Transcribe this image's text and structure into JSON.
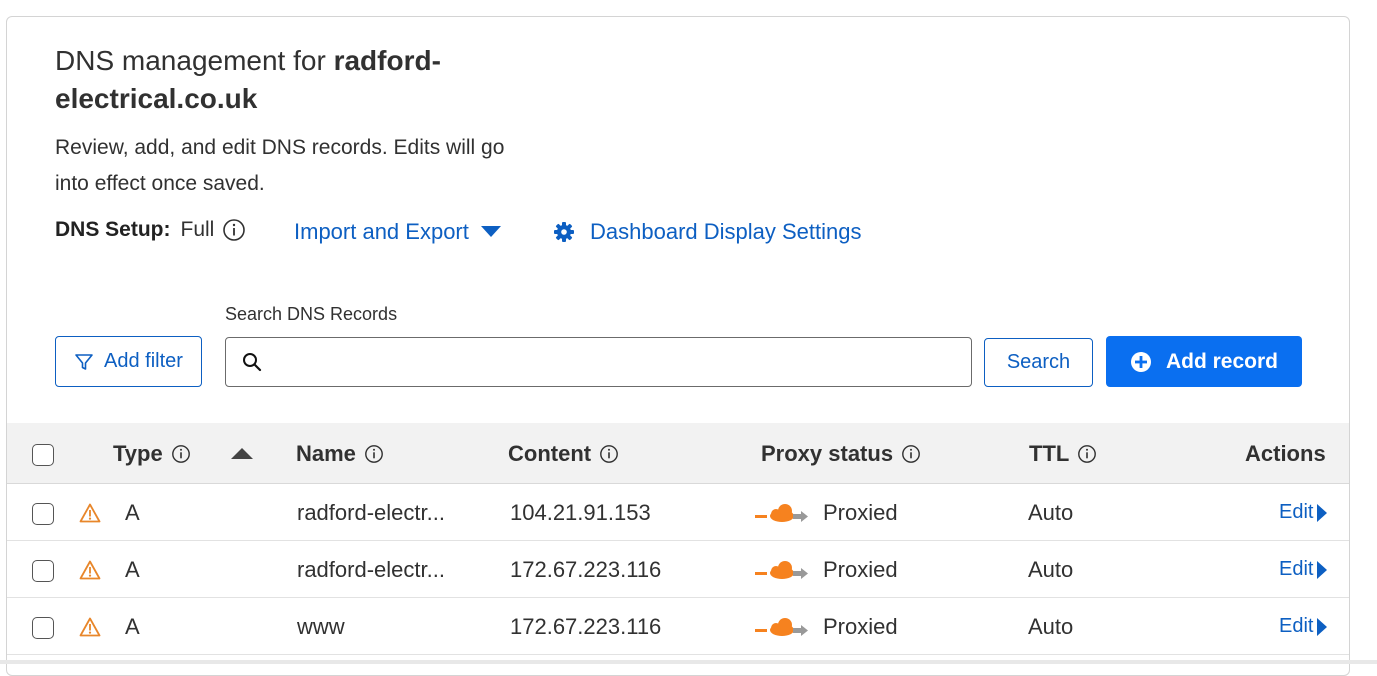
{
  "header": {
    "title_prefix": "DNS management for ",
    "domain": "radford-electrical.co.uk",
    "description": "Review, add, and edit DNS records. Edits will go into effect once saved.",
    "setup_label": "DNS Setup:",
    "setup_value": "Full"
  },
  "links": {
    "import_export": "Import and Export",
    "display_settings": "Dashboard Display Settings"
  },
  "toolbar": {
    "search_label": "Search DNS Records",
    "search_value": "",
    "add_filter": "Add filter",
    "search_button": "Search",
    "add_record": "Add record"
  },
  "table": {
    "columns": {
      "type": "Type",
      "name": "Name",
      "content": "Content",
      "proxy": "Proxy status",
      "ttl": "TTL",
      "actions": "Actions"
    },
    "rows": [
      {
        "type": "A",
        "name": "radford-electr...",
        "content": "104.21.91.153",
        "proxy": "Proxied",
        "ttl": "Auto",
        "action": "Edit"
      },
      {
        "type": "A",
        "name": "radford-electr...",
        "content": "172.67.223.116",
        "proxy": "Proxied",
        "ttl": "Auto",
        "action": "Edit"
      },
      {
        "type": "A",
        "name": "www",
        "content": "172.67.223.116",
        "proxy": "Proxied",
        "ttl": "Auto",
        "action": "Edit"
      }
    ]
  },
  "colors": {
    "link": "#0d5fc2",
    "primary_button": "#0a6ff0",
    "warning": "#e8862a",
    "cloud": "#f6821f"
  },
  "icons": {
    "info": "info-icon",
    "filter": "filter-icon",
    "search": "search-icon",
    "gear": "gear-icon",
    "caret": "caret-down-icon",
    "plus": "plus-circle-icon",
    "warning": "warning-icon",
    "cloud": "cloud-icon",
    "sort": "sort-up-icon"
  }
}
